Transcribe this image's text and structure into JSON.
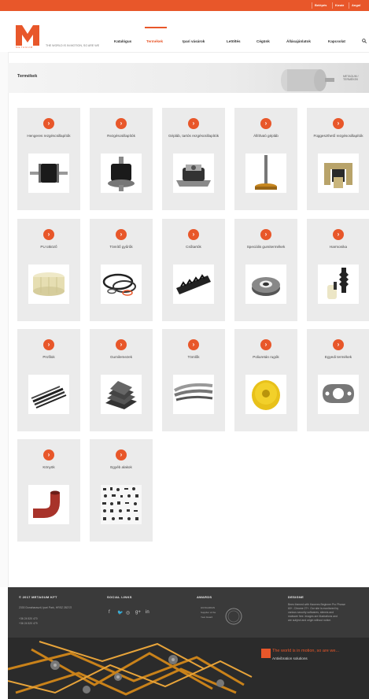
{
  "topbar": {
    "links": [
      "Belépés",
      "Kosár",
      "Angol"
    ]
  },
  "brand": {
    "logo_sub": "METAGUM",
    "tagline": "THE WORLD IS IN MOTION, SO ARE WE"
  },
  "nav": {
    "items": [
      "Katalógus",
      "Termékek",
      "Ipari vásárok",
      "Letöltés",
      "Cégünk",
      "Állásajánlatok",
      "Kapcsolat"
    ],
    "active": "Termékek"
  },
  "banner": {
    "title": "Termékek",
    "breadcrumb": "METAGUM / TERMÉKEK"
  },
  "products": [
    "Hengeres rezgéscsillapítók",
    "Rezgéscsillapítók",
    "Gépláb, tartós rezgéscsillapítók",
    "Állítható gépláb",
    "Függeszthető rezgéscsillapítók",
    "PU ütköző",
    "Tömítő gyűrűk",
    "Csőtartók",
    "Speciális gumitermékek",
    "Harmonika",
    "Profilok",
    "Gumilemezek",
    "Tömlők",
    "Poliuretán rugók",
    "Egyedi termékek",
    "Könyök",
    "Egyéb alakok"
  ],
  "footer": {
    "col1_head": "© 2017 METAGUM KFT",
    "col1_lines": [
      "2330 Dunaharaszti, Ipari Park, HRSZ 2827/2",
      "+36 24 520 470",
      "+36 24 520 479"
    ],
    "col2_head": "SOCIAL LINKS",
    "col3_head": "AWARDS",
    "col3_lines": [
      "HUNGARIAN",
      "Supplier of the",
      "Year Award"
    ],
    "col4_head": "DESIGNE",
    "col4_lines": [
      "Bees themed with Haveres Beginner Pro Phrase",
      "60+, Chrome 27+. Our site is monitored by",
      "various security softwares, sitemis and",
      "malware free. Images are illustrations and",
      "are subject and origin without notice."
    ],
    "slogan": "The world is in motion, so are we...",
    "subslogan": "Antivibration solutions"
  },
  "colors": {
    "accent": "#e8572a",
    "card_bg": "#ebebeb",
    "footer_bg": "#3a3a3a"
  }
}
